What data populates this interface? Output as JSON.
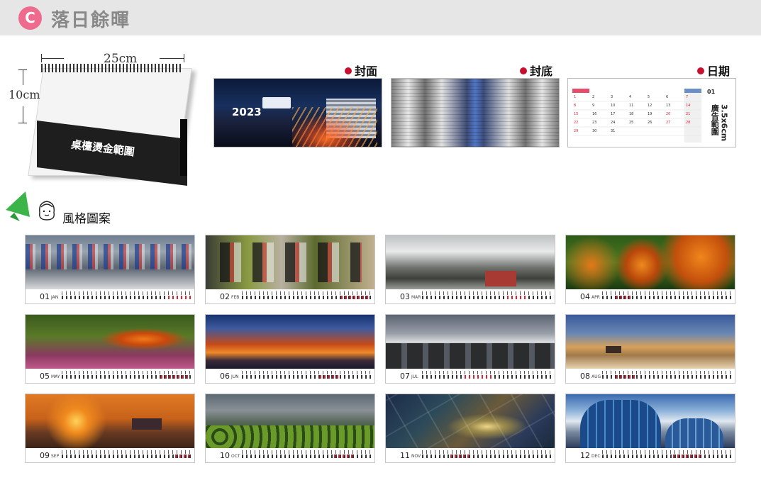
{
  "header": {
    "badge": "C",
    "title": "落日餘暉"
  },
  "mockup": {
    "width_label": "25cm",
    "height_label": "10cm",
    "desk_label": "桌檯燙金範圍"
  },
  "previews": [
    {
      "caption": "封面",
      "year": "2023"
    },
    {
      "caption": "封底"
    },
    {
      "caption": "日期",
      "ad_label": "3.5x6cm廣告範圍",
      "first_month": "01"
    }
  ],
  "style_section": {
    "title": "風格圖案"
  },
  "months": [
    {
      "num": "01",
      "abbr": "JAN"
    },
    {
      "num": "02",
      "abbr": "FEB"
    },
    {
      "num": "03",
      "abbr": "MAR"
    },
    {
      "num": "04",
      "abbr": "APR"
    },
    {
      "num": "05",
      "abbr": "MAY"
    },
    {
      "num": "06",
      "abbr": "JUN"
    },
    {
      "num": "07",
      "abbr": "JUL"
    },
    {
      "num": "08",
      "abbr": "AUG"
    },
    {
      "num": "09",
      "abbr": "SEP"
    },
    {
      "num": "10",
      "abbr": "OCT"
    },
    {
      "num": "11",
      "abbr": "NOV"
    },
    {
      "num": "12",
      "abbr": "DEC"
    }
  ],
  "colors": {
    "badge": "#ee6b8e",
    "accent_dot": "#c8102e",
    "header_bg": "#e6e6e6"
  },
  "icons": [
    "green-arrow-icon",
    "girl-face-icon"
  ]
}
